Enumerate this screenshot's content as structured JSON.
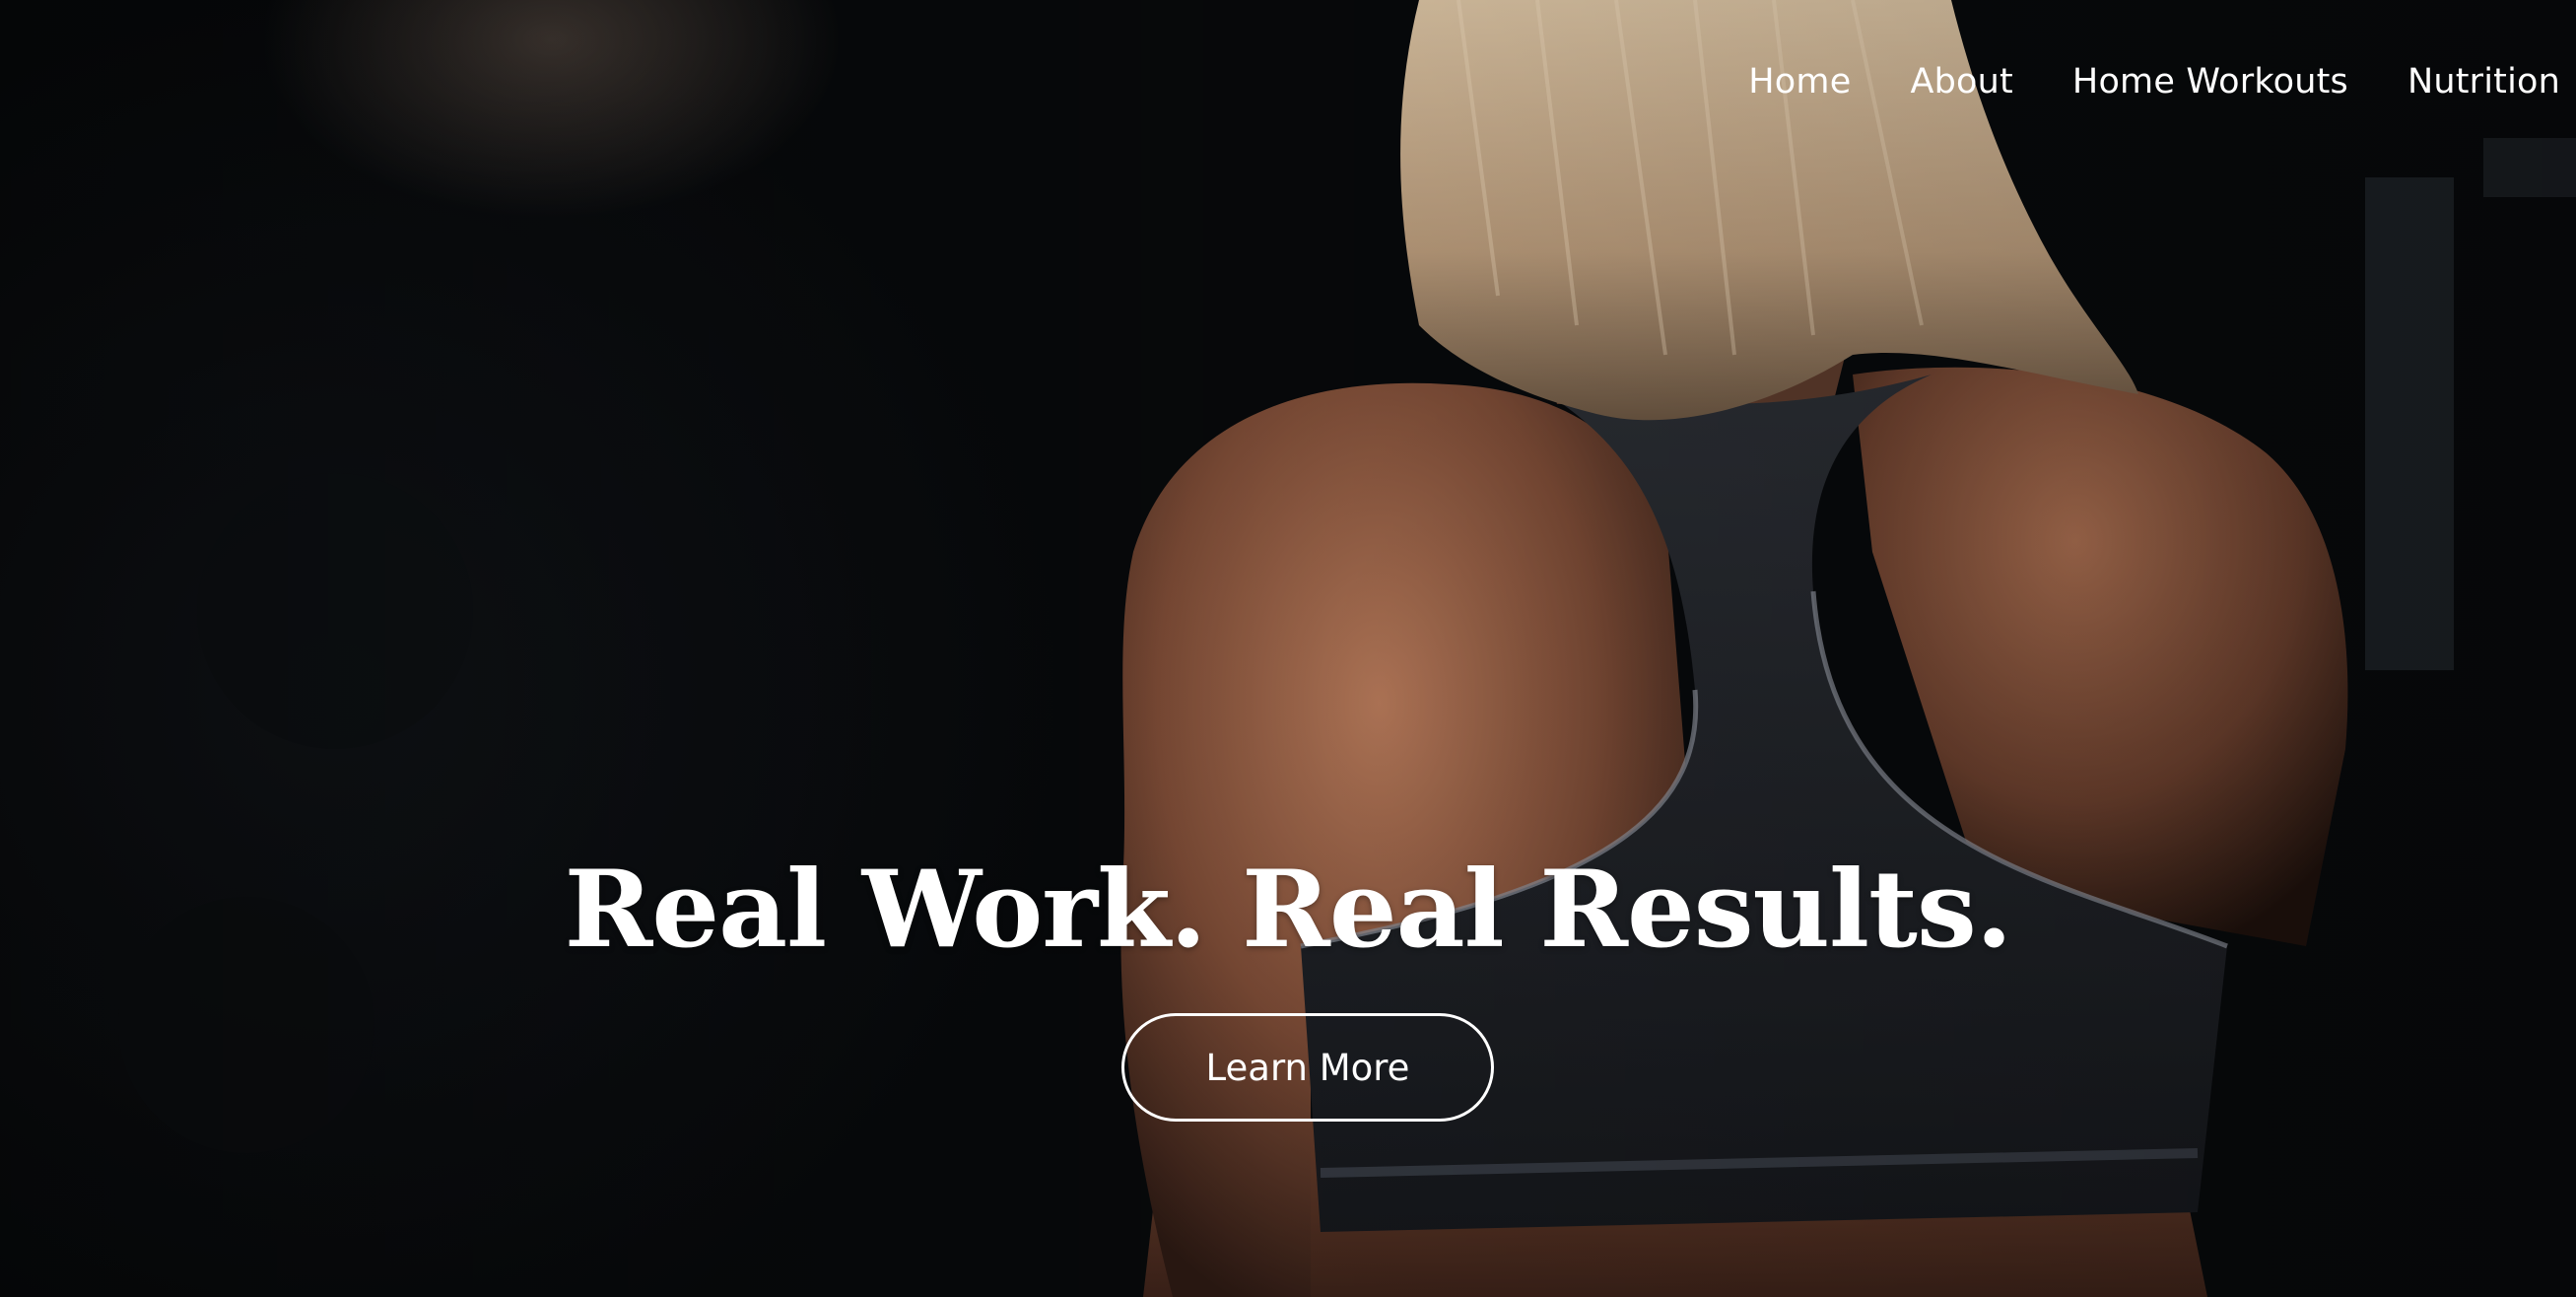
{
  "nav": {
    "items": [
      {
        "label": "Home"
      },
      {
        "label": "About"
      },
      {
        "label": "Home Workouts"
      },
      {
        "label": "Nutrition"
      }
    ]
  },
  "hero": {
    "headline": "Real Work. Real Results.",
    "cta_label": "Learn More",
    "background_image": "athlete-back-photo"
  },
  "colors": {
    "text": "#ffffff",
    "background": "#080a0c",
    "button_border": "#ffffff"
  }
}
